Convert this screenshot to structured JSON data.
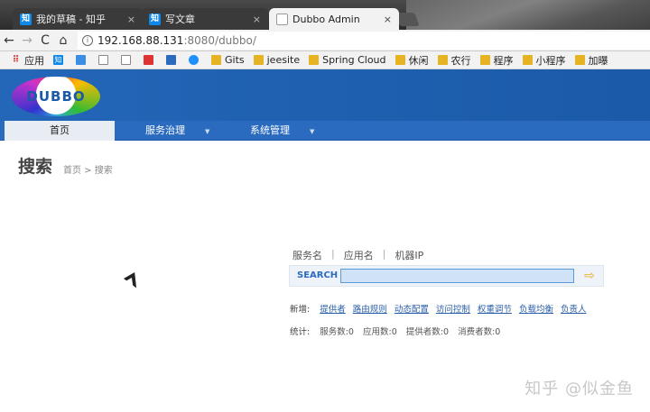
{
  "browser": {
    "tabs": [
      {
        "favicon": "知",
        "title": "我的草稿 - 知乎",
        "close": "×"
      },
      {
        "favicon": "知",
        "title": "写文章",
        "close": "×"
      },
      {
        "favicon": "",
        "title": "Dubbo Admin",
        "close": "×"
      }
    ],
    "nav": {
      "back": "←",
      "forward": "→",
      "reload": "C",
      "home": "⌂"
    },
    "url": {
      "host": "192.168.88.131",
      "rest": ":8080/dubbo/"
    },
    "bookmarks": [
      {
        "icon": "apps-grid-icon",
        "label": "应用"
      },
      {
        "icon": "zhihu-icon",
        "label": ""
      },
      {
        "icon": "site-icon",
        "label": ""
      },
      {
        "icon": "doc-icon",
        "label": ""
      },
      {
        "icon": "doc-icon",
        "label": ""
      },
      {
        "icon": "site-icon",
        "label": ""
      },
      {
        "icon": "site-icon",
        "label": ""
      },
      {
        "icon": "site-icon",
        "label": ""
      },
      {
        "icon": "folder-icon",
        "label": "Gits"
      },
      {
        "icon": "folder-icon",
        "label": "jeesite"
      },
      {
        "icon": "folder-icon",
        "label": "Spring Cloud"
      },
      {
        "icon": "folder-icon",
        "label": "休闲"
      },
      {
        "icon": "folder-icon",
        "label": "农行"
      },
      {
        "icon": "folder-icon",
        "label": "程序"
      },
      {
        "icon": "folder-icon",
        "label": "小程序"
      },
      {
        "icon": "folder-icon",
        "label": "加曝"
      }
    ]
  },
  "app": {
    "logo": "DUBBO",
    "menu": [
      {
        "label": "首页",
        "active": true
      },
      {
        "label": "服务治理",
        "caret": "▼"
      },
      {
        "label": "系统管理",
        "caret": "▼"
      }
    ],
    "page_title": "搜索",
    "breadcrumb": "首页 > 搜索",
    "search_tabs": [
      "服务名",
      "应用名",
      "机器IP"
    ],
    "search_separator": "|",
    "search_label": "SEARCH",
    "search_value": "",
    "search_go": "⇨",
    "new_label": "新增:",
    "new_links": [
      "提供者",
      "路由规则",
      "动态配置",
      "访问控制",
      "权重调节",
      "负载均衡",
      "负责人"
    ],
    "stats_label": "统计:",
    "stats": [
      "服务数:0",
      "应用数:0",
      "提供者数:0",
      "消费者数:0"
    ]
  },
  "watermark": "知乎 @似金鱼"
}
